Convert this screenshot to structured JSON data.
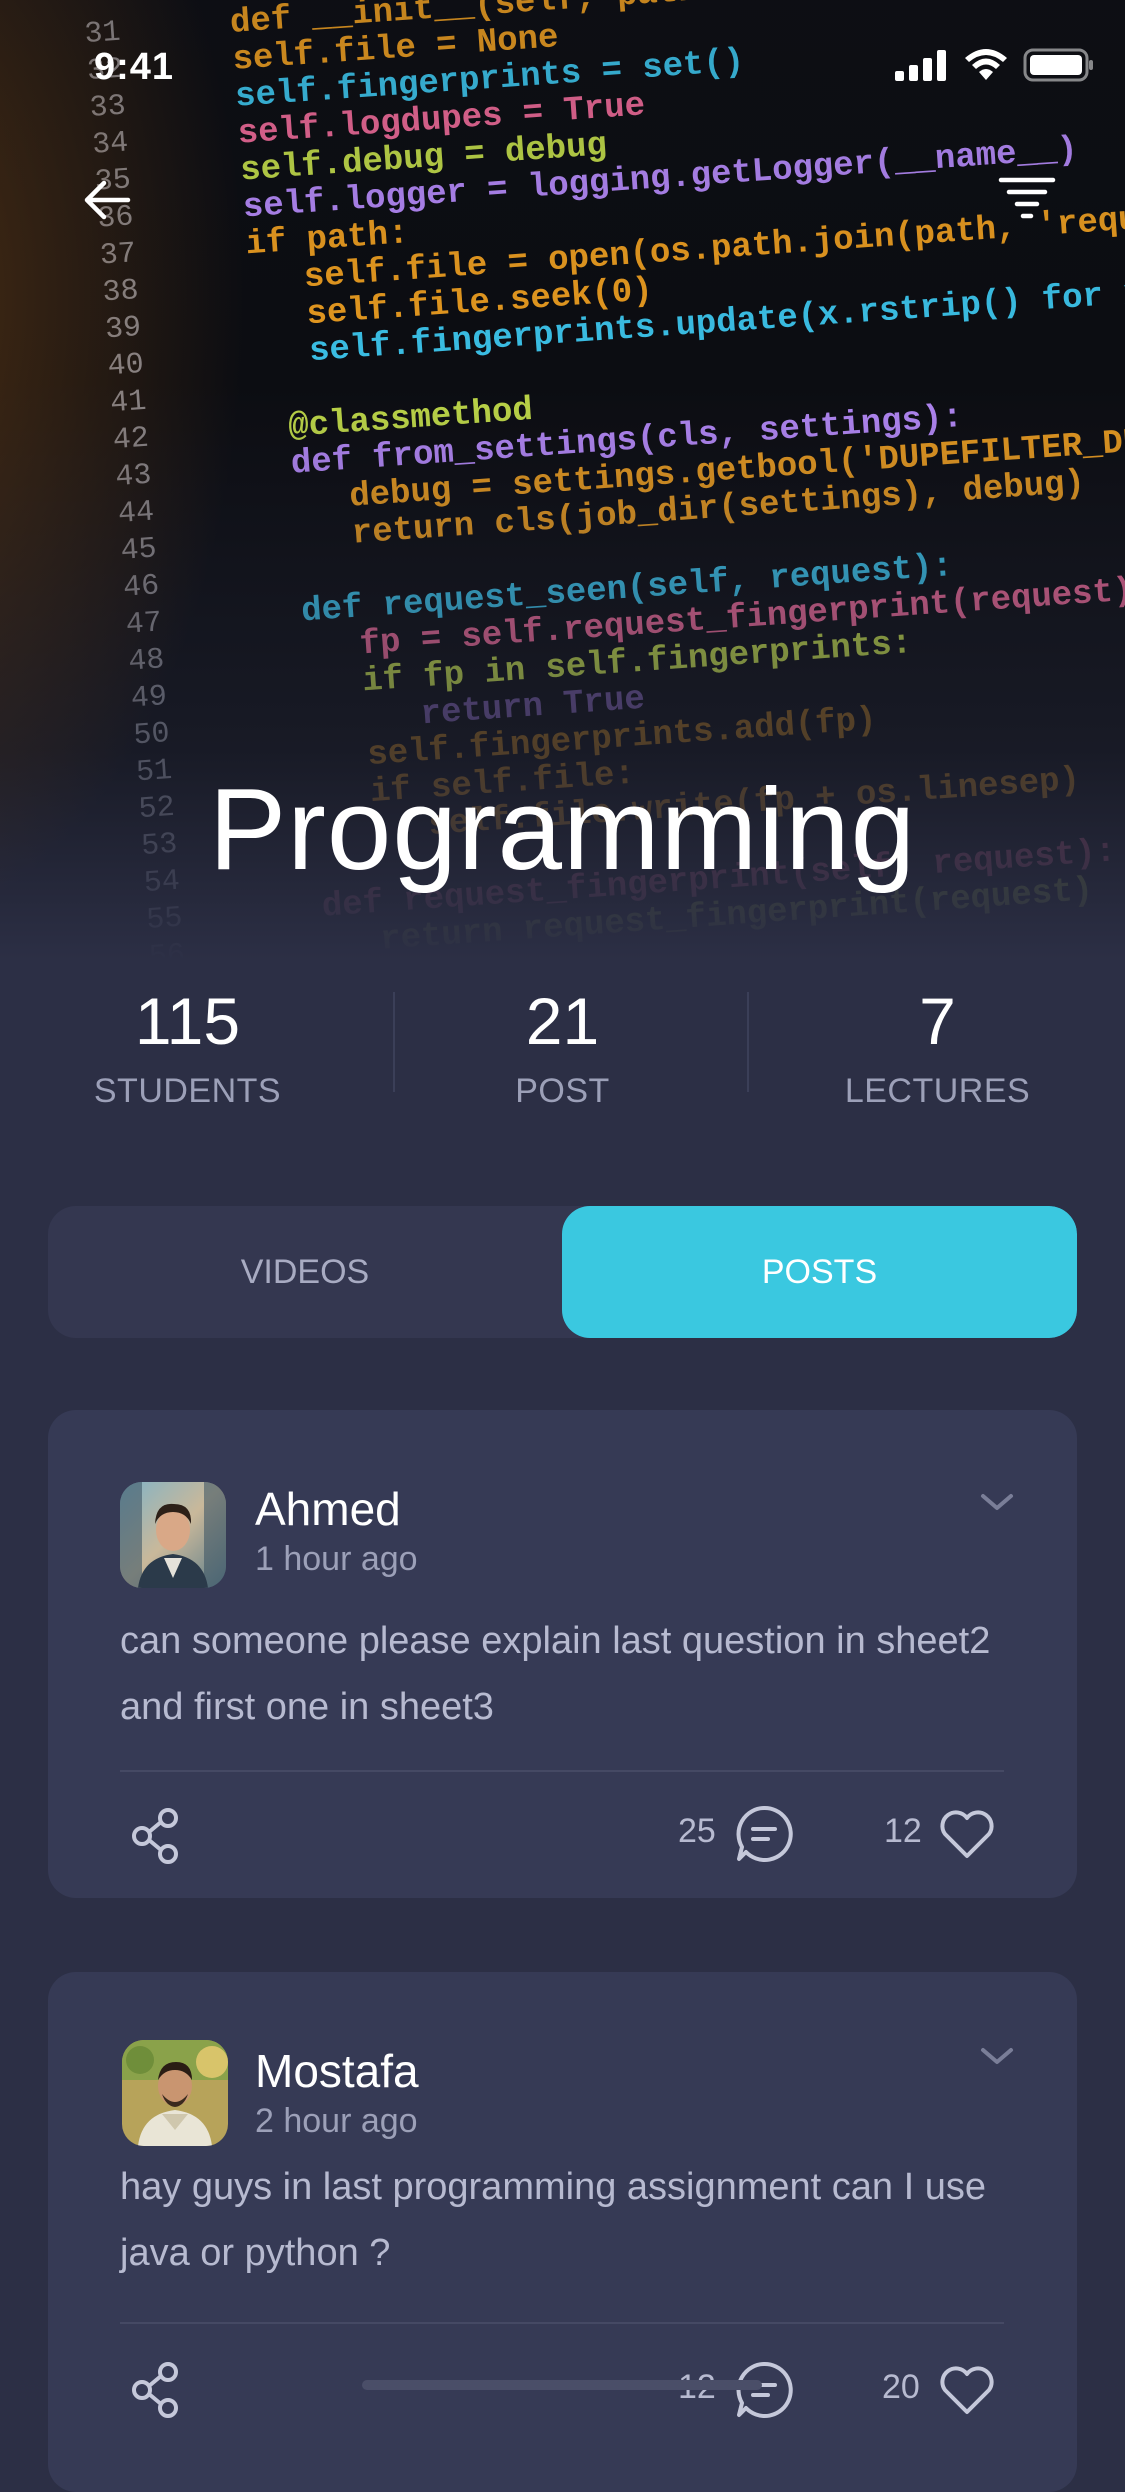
{
  "status_bar": {
    "time": "9:41"
  },
  "hero": {
    "title": "Programming",
    "code_lines": [
      {
        "n": "31",
        "t": "def __init__(self, path=None, debug=False):"
      },
      {
        "n": "32",
        "t": "self.file = None"
      },
      {
        "n": "33",
        "t": "self.fingerprints = set()"
      },
      {
        "n": "34",
        "t": "self.logdupes = True"
      },
      {
        "n": "35",
        "t": "self.debug = debug"
      },
      {
        "n": "36",
        "t": "self.logger = logging.getLogger(__name__)"
      },
      {
        "n": "37",
        "t": "if path:"
      },
      {
        "n": "38",
        "t": "    self.file = open(os.path.join(path, 'requests.seen'), 'a+')"
      },
      {
        "n": "39",
        "t": "    self.file.seek(0)"
      },
      {
        "n": "40",
        "t": "    self.fingerprints.update(x.rstrip() for x in self.file)"
      },
      {
        "n": "41",
        "t": ""
      },
      {
        "n": "42",
        "t": "@classmethod"
      },
      {
        "n": "43",
        "t": "def from_settings(cls, settings):"
      },
      {
        "n": "44",
        "t": "    debug = settings.getbool('DUPEFILTER_DEBUG')"
      },
      {
        "n": "45",
        "t": "    return cls(job_dir(settings), debug)"
      },
      {
        "n": "46",
        "t": ""
      },
      {
        "n": "47",
        "t": "def request_seen(self, request):"
      },
      {
        "n": "48",
        "t": "    fp = self.request_fingerprint(request)"
      },
      {
        "n": "49",
        "t": "    if fp in self.fingerprints:"
      },
      {
        "n": "50",
        "t": "        return True"
      },
      {
        "n": "51",
        "t": "    self.fingerprints.add(fp)"
      },
      {
        "n": "52",
        "t": "    if self.file:"
      },
      {
        "n": "53",
        "t": "        self.file.write(fp + os.linesep)"
      },
      {
        "n": "54",
        "t": ""
      },
      {
        "n": "55",
        "t": "def request_fingerprint(self, request):"
      },
      {
        "n": "56",
        "t": "    return request_fingerprint(request)"
      }
    ]
  },
  "stats": [
    {
      "value": "115",
      "label": "STUDENTS"
    },
    {
      "value": "21",
      "label": "POST"
    },
    {
      "value": "7",
      "label": "LECTURES"
    }
  ],
  "tabs": [
    {
      "label": "VIDEOS",
      "active": false
    },
    {
      "label": "POSTS",
      "active": true
    }
  ],
  "posts": [
    {
      "author": "Ahmed",
      "time": "1 hour ago",
      "text": "can someone please explain last question in sheet2 and first one in sheet3",
      "comments": "25",
      "likes": "12"
    },
    {
      "author": "Mostafa",
      "time": "2 hour ago",
      "text": "hay guys in last programming assignment can I use java or python ?",
      "comments": "12",
      "likes": "20"
    }
  ],
  "colors": {
    "background": "#2c2f45",
    "card": "#363a55",
    "accent": "#3ac8e0",
    "muted_text": "#9ca0b8"
  },
  "icons": {
    "back": "arrow-left-icon",
    "filter": "filter-icon",
    "chevron": "chevron-down-icon",
    "share": "share-icon",
    "comment": "comment-icon",
    "like": "heart-icon"
  }
}
